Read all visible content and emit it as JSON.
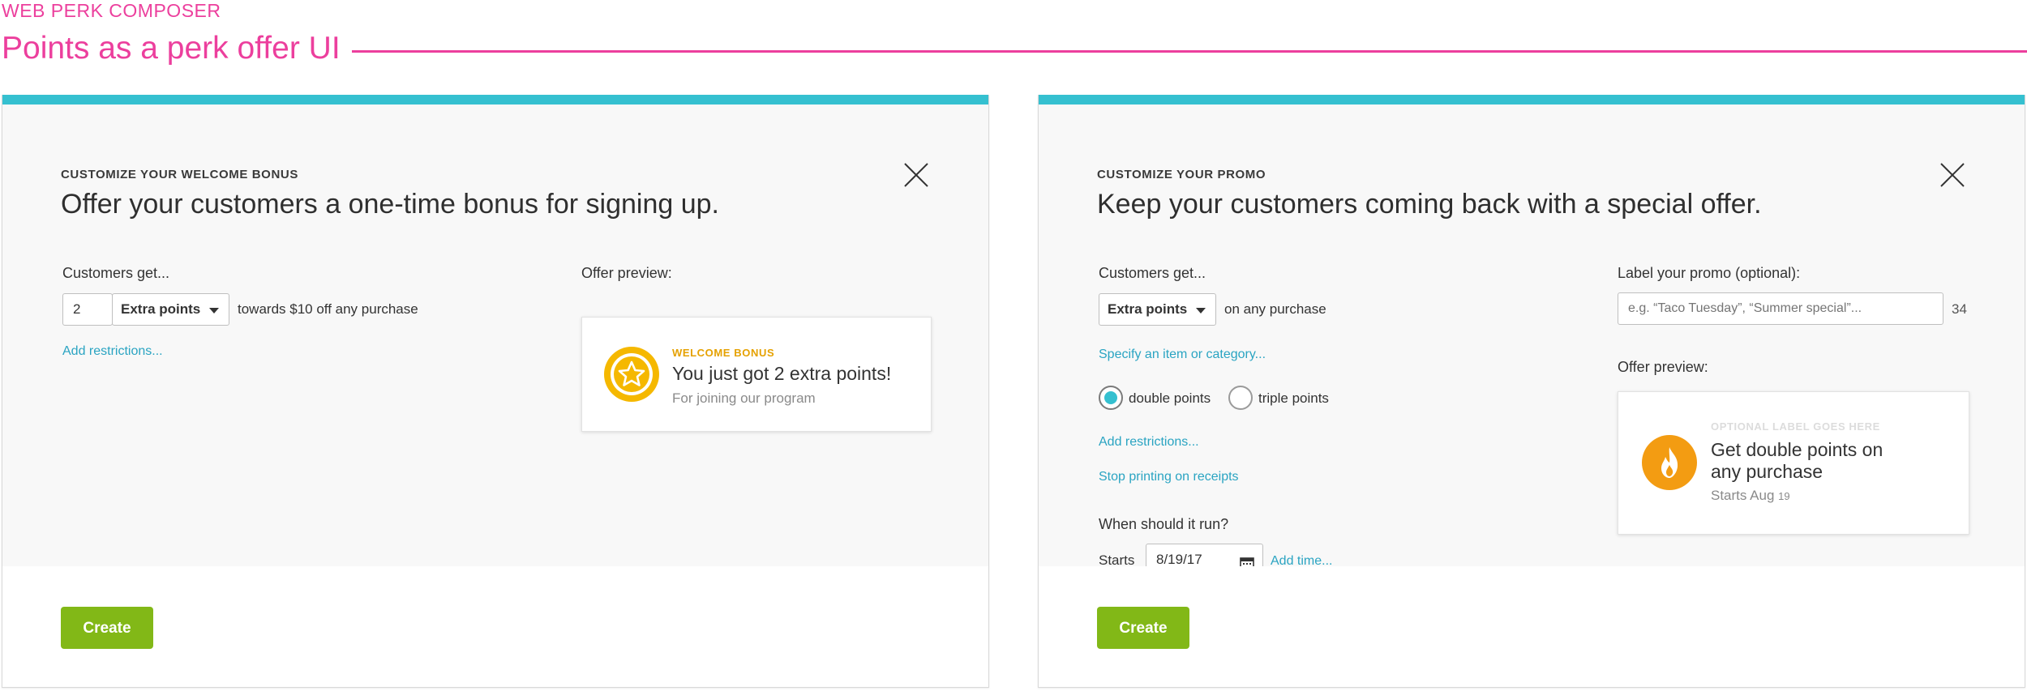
{
  "header": {
    "eyebrow": "WEB PERK COMPOSER",
    "title": "Points as a perk offer UI",
    "accent_color": "#ec3f9d"
  },
  "welcome_panel": {
    "kicker": "CUSTOMIZE YOUR WELCOME BONUS",
    "headline": "Offer your customers a one-time bonus for signing up.",
    "customers_get_label": "Customers get...",
    "amount_value": "2",
    "reward_type_selected": "Extra points",
    "towards_text": "towards $10 off any purchase",
    "add_restrictions_link": "Add restrictions...",
    "offer_preview_label": "Offer preview:",
    "preview": {
      "kicker": "WELCOME BONUS",
      "title": "You just got 2 extra points!",
      "subtitle": "For joining our program",
      "icon": "star-badge-icon",
      "kicker_color": "#e5a100"
    },
    "create_button": "Create",
    "close_icon": "close-icon"
  },
  "promo_panel": {
    "kicker": "CUSTOMIZE YOUR PROMO",
    "headline": "Keep your customers coming back with a special offer.",
    "customers_get_label": "Customers get...",
    "reward_type_selected": "Extra points",
    "on_purchase_text": "on any purchase",
    "specify_item_link": "Specify an item or category...",
    "radio_options": [
      {
        "label": "double points",
        "selected": true
      },
      {
        "label": "triple points",
        "selected": false
      }
    ],
    "add_restrictions_link": "Add restrictions...",
    "stop_printing_link": "Stop printing on receipts",
    "when_label": "When should it run?",
    "starts_label": "Starts",
    "start_date_value": "8/19/17",
    "add_time_link": "Add time...",
    "promo_label_title": "Label your promo (optional):",
    "promo_label_placeholder": "e.g. “Taco Tuesday”, “Summer special”...",
    "char_count": "34",
    "offer_preview_label": "Offer preview:",
    "preview": {
      "kicker": "OPTIONAL LABEL GOES HERE",
      "title": "Get double points on any purchase",
      "subtitle_prefix": "Starts Aug ",
      "subtitle_day": "19",
      "icon": "flame-icon"
    },
    "create_button": "Create",
    "close_icon": "close-icon"
  },
  "colors": {
    "panel_accent": "#35c0d0",
    "link": "#2aa4c2",
    "create_button": "#82b817",
    "badge_gold": "#f5b800",
    "flame_orange": "#f39c12"
  }
}
